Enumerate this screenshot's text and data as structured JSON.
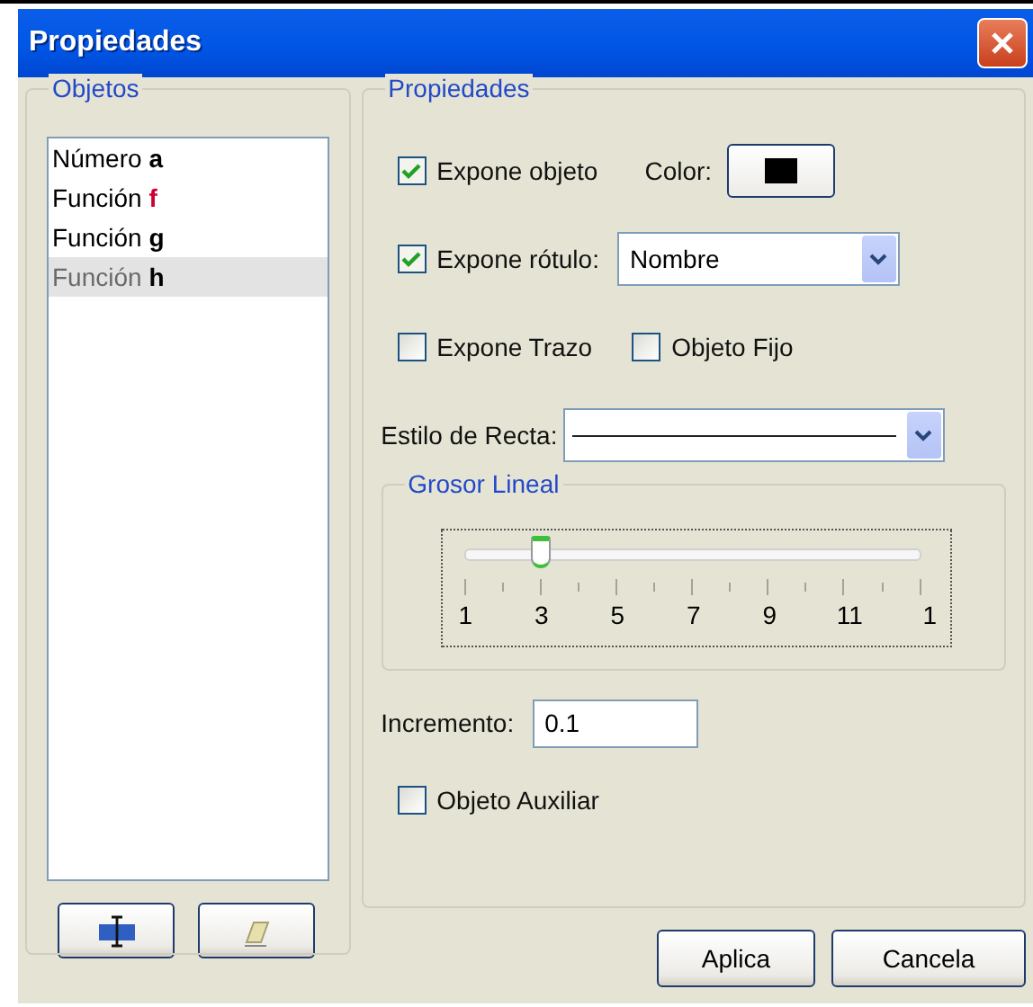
{
  "window": {
    "title": "Propiedades"
  },
  "objects": {
    "legend": "Objetos",
    "items": [
      {
        "label": "Número",
        "var": "a",
        "color": "#000000",
        "selected": false
      },
      {
        "label": "Función",
        "var": "f",
        "color": "#cc0033",
        "selected": false
      },
      {
        "label": "Función",
        "var": "g",
        "color": "#000000",
        "selected": false
      },
      {
        "label": "Función",
        "var": "h",
        "color": "#000000",
        "selected": true
      }
    ]
  },
  "properties": {
    "legend": "Propiedades",
    "show_object": {
      "label": "Expone objeto",
      "checked": true
    },
    "color": {
      "label": "Color:"
    },
    "show_label": {
      "label": "Expone rótulo:",
      "checked": true,
      "value": "Nombre"
    },
    "trace": {
      "label": "Expone Trazo",
      "checked": false
    },
    "fixed": {
      "label": "Objeto Fijo",
      "checked": false
    },
    "line_style": {
      "label": "Estilo de Recta:"
    },
    "thickness": {
      "legend": "Grosor Lineal",
      "level": 0.1667,
      "tick_labels": [
        "1",
        "3",
        "5",
        "7",
        "9",
        "11",
        "1"
      ]
    },
    "increment": {
      "label": "Incremento:",
      "value": "0.1"
    },
    "auxiliary": {
      "label": "Objeto Auxiliar",
      "checked": false
    }
  },
  "buttons": [
    {
      "label": "Aplica"
    },
    {
      "label": "Cancela"
    }
  ]
}
